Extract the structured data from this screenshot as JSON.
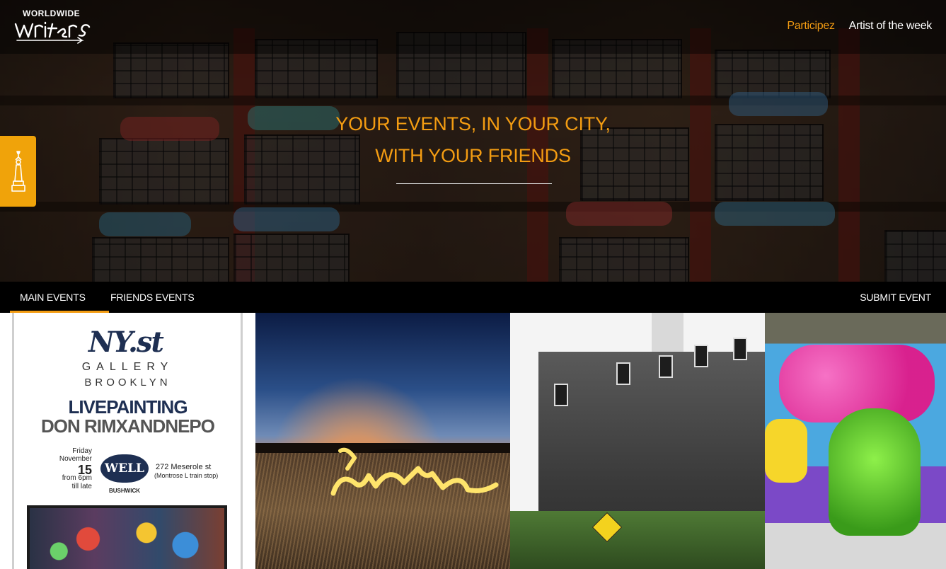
{
  "header": {
    "logo_top": "WORLDWIDE",
    "logo_script": "Writers",
    "nav": [
      {
        "label": "Participez",
        "color": "#f39c12"
      },
      {
        "label": "Artist of the week",
        "color": "#ffffff"
      }
    ]
  },
  "hero": {
    "headline_line1": "YOUR EVENTS, IN YOUR CITY,",
    "headline_line2": "WITH YOUR FRIENDS",
    "accent_color": "#f39c12",
    "side_tab_icon": "statue-of-liberty-icon"
  },
  "tabs": {
    "main": "MAIN EVENTS",
    "friends": "FRIENDS EVENTS",
    "submit": "SUBMIT EVENT",
    "active": "main"
  },
  "events": [
    {
      "poster": {
        "brand": "NY.st",
        "gallery": "GALLERY",
        "city": "BROOKLYN",
        "title_line1": "LIVEPAINTING",
        "title_line2": "DON RIMXANDNEPO",
        "day": "Friday",
        "month": "November",
        "date": "15",
        "time": "from 6pm",
        "till": "till late",
        "venue_logo": "WELL",
        "venue_sub": "BUSHWICK",
        "address": "272 Meserole st",
        "address_note": "(Montrose L train stop)"
      }
    },
    {
      "image": "light-calligraphy-field-night"
    },
    {
      "image": "home-mural-building"
    },
    {
      "image": "pink-green-graffiti-wall"
    }
  ]
}
